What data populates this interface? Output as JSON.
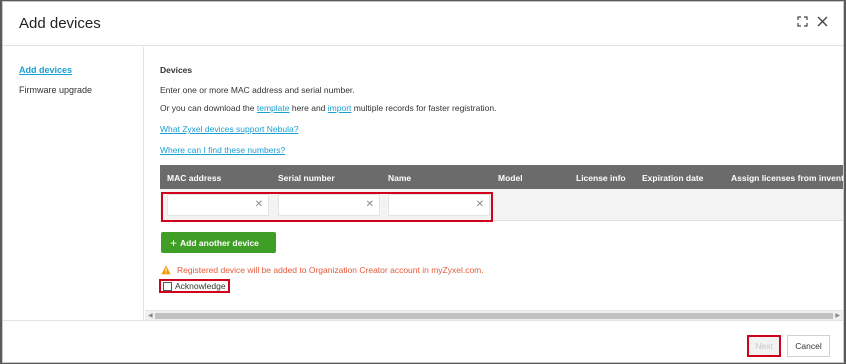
{
  "dialog": {
    "title": "Add devices"
  },
  "sidebar": {
    "items": [
      {
        "label": "Add devices"
      },
      {
        "label": "Firmware upgrade"
      }
    ]
  },
  "main": {
    "section_title": "Devices",
    "intro": "Enter one or more MAC address and serial number.",
    "download_prefix": "Or you can download the ",
    "template_link": "template",
    "download_mid": " here and ",
    "import_link": "import",
    "download_suffix": " multiple records for faster registration.",
    "support_link": "What Zyxel devices support Nebula?",
    "find_link": "Where can I find these numbers?",
    "table": {
      "columns": [
        "MAC address",
        "Serial number",
        "Name",
        "Model",
        "License info",
        "Expiration date",
        "Assign licenses from invent"
      ],
      "row": {
        "mac_value": "",
        "serial_value": "",
        "name_value": ""
      }
    },
    "add_button": "Add another device",
    "warning": "Registered device will be added to Organization Creator account in myZyxel.com.",
    "acknowledge": "Acknowledge"
  },
  "footer": {
    "next": "Next",
    "cancel": "Cancel"
  },
  "colors": {
    "accent": "#1a9fd1",
    "add_button": "#3f9e26",
    "warning": "#e45a39",
    "highlight": "#d0021b",
    "table_header": "#6b6b6b"
  },
  "icons": {
    "fullscreen": "fullscreen-icon",
    "close": "close-icon",
    "warning": "warning-icon",
    "clear": "clear-icon"
  }
}
